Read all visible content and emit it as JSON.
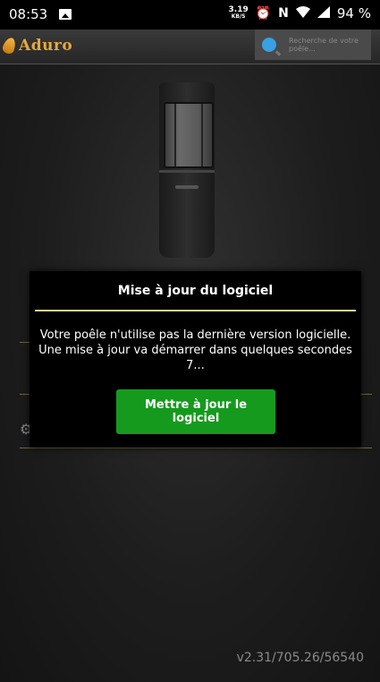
{
  "statusbar": {
    "time": "08:53",
    "speed_value": "3.19",
    "speed_unit": "KB/S",
    "battery": "94 %",
    "icons": [
      "image-icon",
      "alarm-icon",
      "nfc-icon",
      "wifi-icon",
      "signal-icon"
    ]
  },
  "appbar": {
    "logo_text": "Aduro",
    "search_placeholder": "Recherche de votre poêle..."
  },
  "dialog": {
    "title": "Mise à jour du logiciel",
    "message_line1": "Votre poêle n'utilise pas la dernière version logicielle.",
    "message_line2": "Une mise à jour va démarrer dans quelques secondes",
    "countdown": "7...",
    "button_label": "Mettre à jour le logiciel"
  },
  "footer": {
    "version": "v2.31/705.26/56540"
  },
  "colors": {
    "accent_gold": "#e7a93a",
    "button_green": "#159a1d",
    "separator": "#d7d59a",
    "search_icon": "#39a0e3"
  }
}
